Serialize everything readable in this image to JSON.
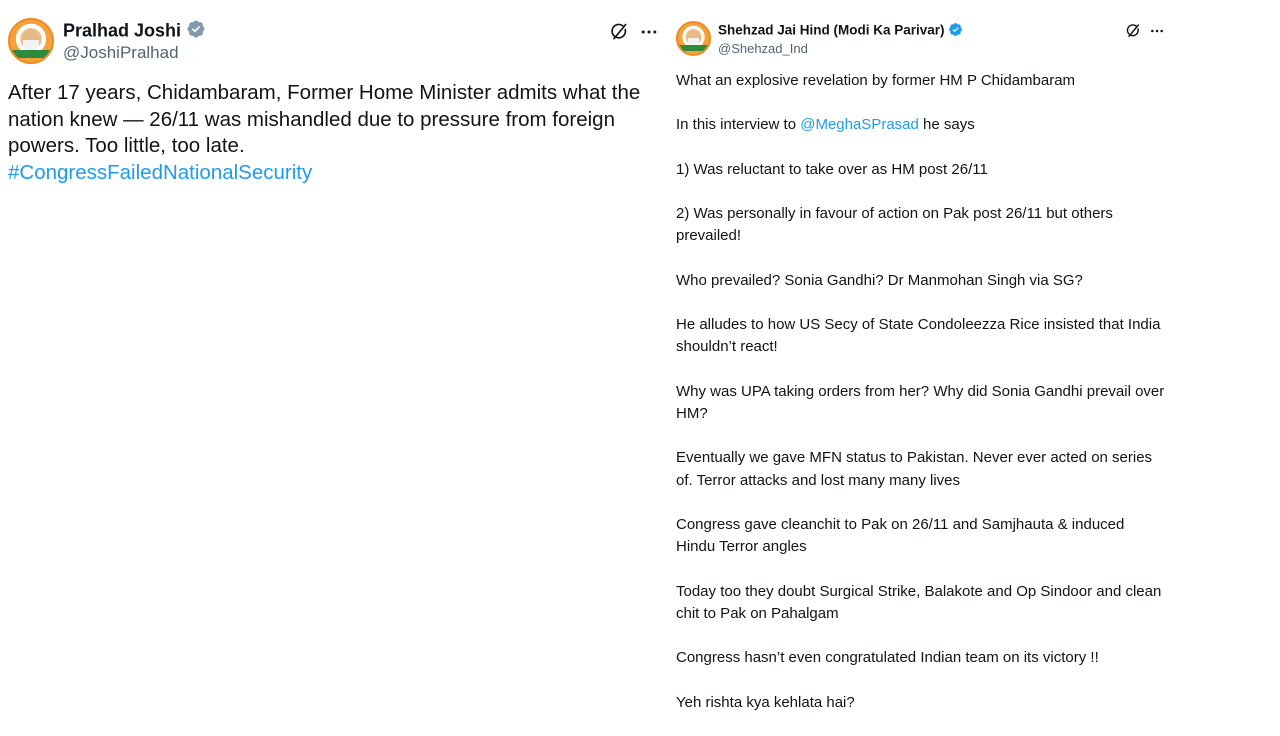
{
  "left_tweet": {
    "author_name": "Pralhad Joshi",
    "author_handle": "@JoshiPralhad",
    "verified_icon": "verified-badge-gray",
    "actions": {
      "grok_icon": "grok-icon",
      "more_icon": "more-icon"
    },
    "text": "After 17 years, Chidambaram, Former Home Minister admits what the nation knew — 26/11 was mishandled due to pressure from foreign powers. Too little, too late.",
    "hashtag": "#CongressFailedNationalSecurity"
  },
  "right_tweet": {
    "author_name": "Shehzad Jai Hind (Modi Ka Parivar)",
    "author_handle": "@Shehzad_Ind",
    "verified_icon": "verified-badge-blue",
    "actions": {
      "grok_icon": "grok-icon",
      "more_icon": "more-icon"
    },
    "paragraphs": [
      "What an explosive revelation by former HM P Chidambaram",
      {
        "before": "In this interview to ",
        "mention": "@MeghaSPrasad",
        "after": " he says"
      },
      "1) Was reluctant to take over as HM post 26/11",
      "2) Was personally in favour of action on Pak post 26/11 but others prevailed!",
      "Who prevailed? Sonia Gandhi? Dr Manmohan Singh via SG?",
      "He alludes to how US Secy of State Condoleezza Rice insisted that India shouldn’t react!",
      "Why was UPA taking orders from her? Why did Sonia Gandhi prevail over HM?",
      "Eventually we gave MFN status to Pakistan. Never ever acted on series of. Terror attacks and lost many many lives",
      "Congress gave cleanchit to Pak on 26/11 and Samjhauta & induced Hindu Terror angles",
      "Today too they doubt Surgical Strike, Balakote and Op Sindoor and clean chit to Pak on Pahalgam",
      "Congress hasn’t even congratulated Indian team on its victory !!",
      "Yeh rishta kya kehlata hai?"
    ]
  },
  "colors": {
    "text": "#0f1419",
    "secondary": "#536471",
    "link": "#1d9bf0",
    "verified_blue": "#1d9bf0",
    "verified_gray": "#829aab"
  }
}
